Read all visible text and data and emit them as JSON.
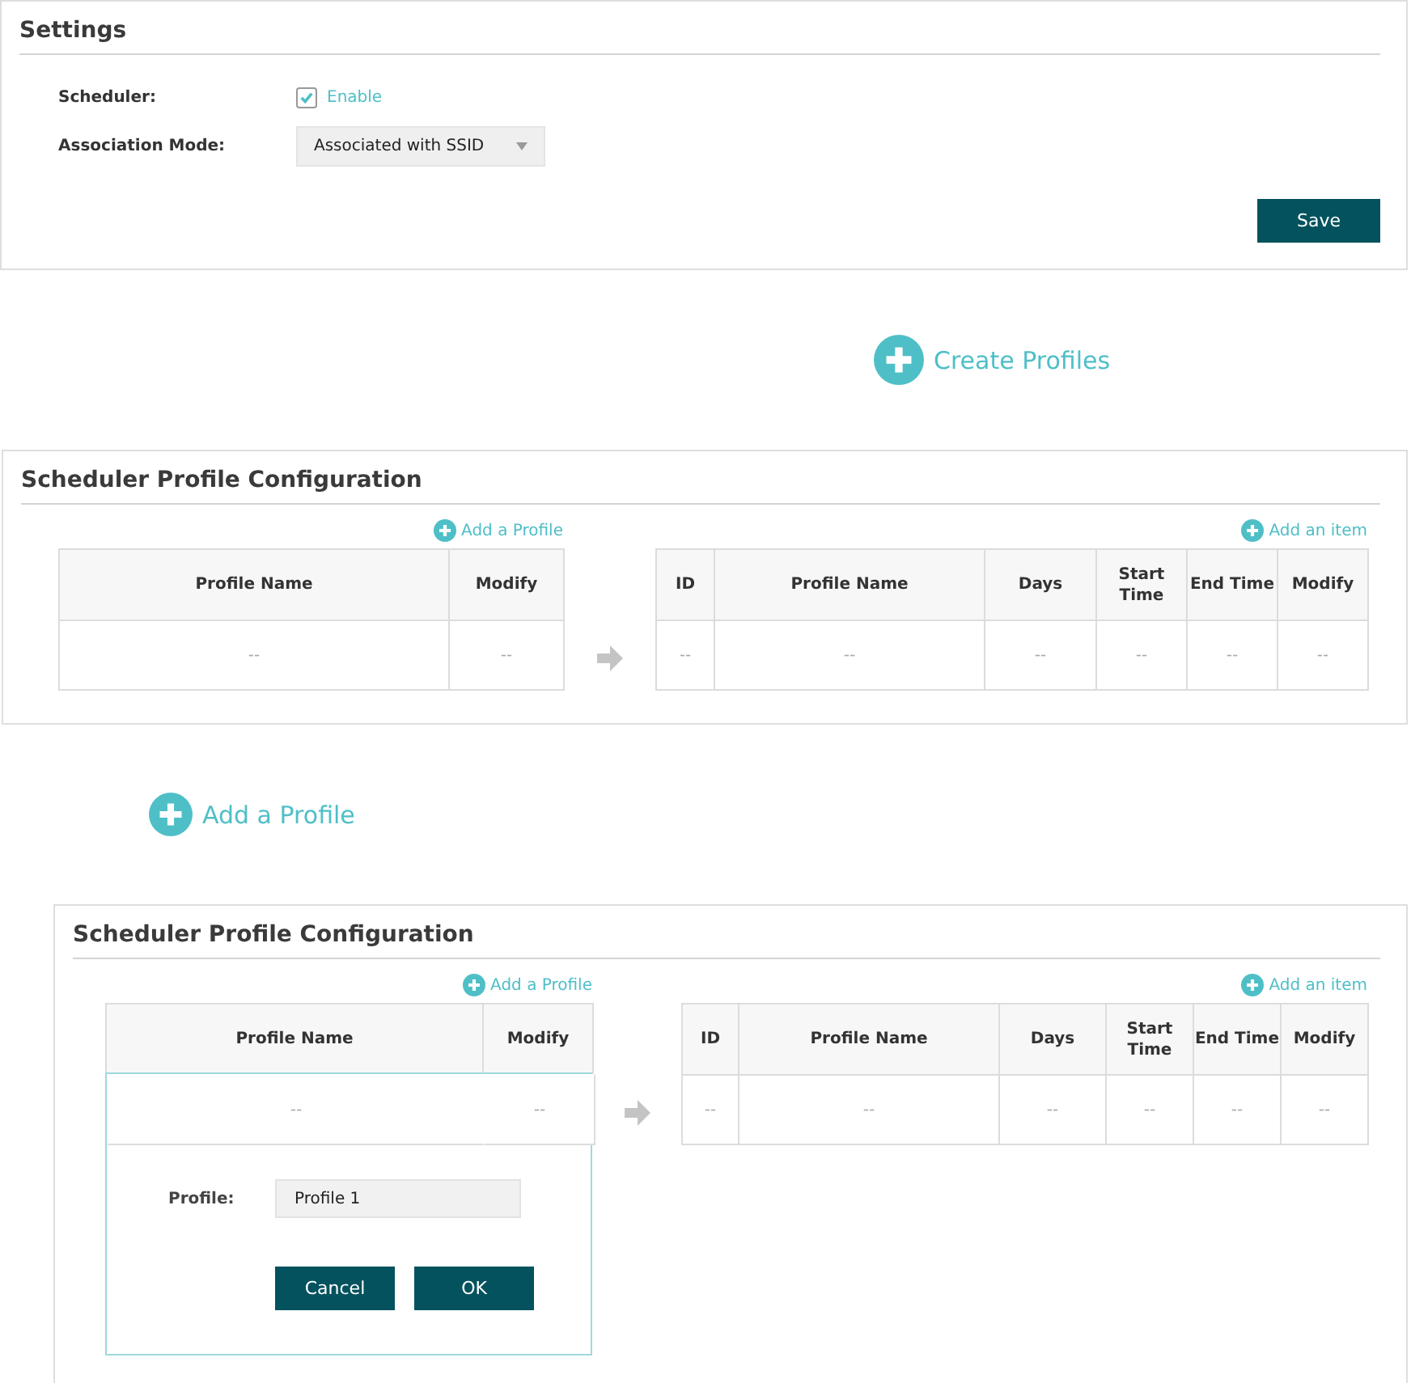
{
  "settings": {
    "title": "Settings",
    "scheduler": {
      "label": "Scheduler:",
      "checked": true,
      "option": "Enable"
    },
    "association_mode": {
      "label": "Association Mode:",
      "value": "Associated with SSID"
    },
    "save_button": "Save"
  },
  "steps": [
    {
      "kind": "callout",
      "label": "Create Profiles"
    },
    {
      "kind": "panel",
      "title": "Scheduler Profile Configuration",
      "add_profile": "Add a Profile",
      "add_item": "Add an item",
      "profiles_table": {
        "columns": [
          "Profile Name",
          "Modify"
        ],
        "rows": [
          [
            "--",
            "--"
          ]
        ]
      },
      "items_table": {
        "columns": [
          "ID",
          "Profile Name",
          "Days",
          "Start Time",
          "End Time",
          "Modify"
        ],
        "rows": [
          [
            "--",
            "--",
            "--",
            "--",
            "--",
            "--"
          ]
        ]
      }
    },
    {
      "kind": "callout",
      "label": "Add a Profile"
    },
    {
      "kind": "panel",
      "title": "Scheduler Profile Configuration",
      "add_profile": "Add a Profile",
      "add_item": "Add an item",
      "profiles_table": {
        "columns": [
          "Profile Name",
          "Modify"
        ],
        "rows": [
          [
            "--",
            "--"
          ]
        ]
      },
      "items_table": {
        "columns": [
          "ID",
          "Profile Name",
          "Days",
          "Start Time",
          "End Time",
          "Modify"
        ],
        "rows": [
          [
            "--",
            "--",
            "--",
            "--",
            "--",
            "--"
          ]
        ]
      },
      "editor": {
        "label": "Profile:",
        "value": "Profile 1",
        "buttons": [
          "Cancel",
          "OK"
        ]
      }
    }
  ]
}
